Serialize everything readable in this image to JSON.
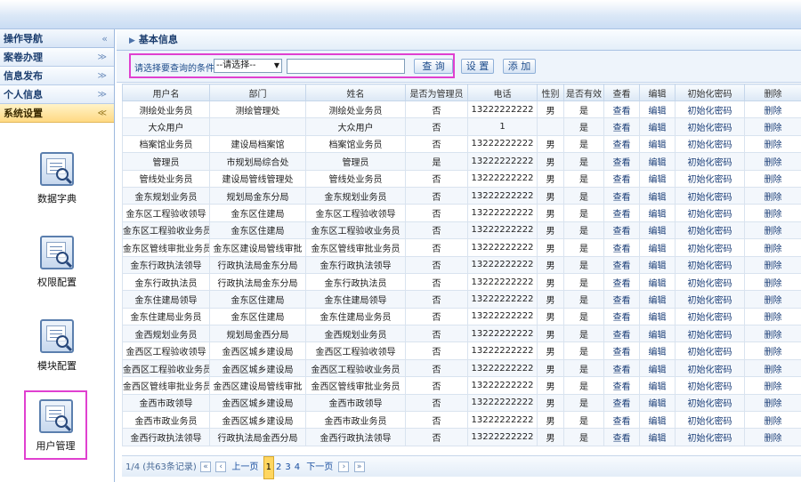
{
  "sidebar": {
    "title": "操作导航",
    "items": [
      {
        "label": "案卷办理"
      },
      {
        "label": "信息发布"
      },
      {
        "label": "个人信息"
      },
      {
        "label": "系统设置"
      }
    ],
    "tools": [
      {
        "label": "数据字典"
      },
      {
        "label": "权限配置"
      },
      {
        "label": "模块配置"
      },
      {
        "label": "用户管理"
      }
    ]
  },
  "main": {
    "breadcrumb": "基本信息",
    "search": {
      "label": "请选择要查询的条件",
      "select_value": "--请选择--",
      "query_button": "查 询",
      "reset_button": "设 置",
      "add_button": "添 加"
    },
    "table": {
      "columns": [
        "用户名",
        "部门",
        "姓名",
        "是否为管理员",
        "电话",
        "性别",
        "是否有效",
        "查看",
        "编辑",
        "初始化密码",
        "删除"
      ],
      "rows": [
        [
          "测绘处业务员",
          "测绘管理处",
          "测绘处业务员",
          "否",
          "13222222222",
          "男",
          "是",
          "查看",
          "编辑",
          "初始化密码",
          "删除"
        ],
        [
          "大众用户",
          "",
          "大众用户",
          "否",
          "1",
          "",
          "是",
          "查看",
          "编辑",
          "初始化密码",
          "删除"
        ],
        [
          "档案馆业务员",
          "建设局档案馆",
          "档案馆业务员",
          "否",
          "13222222222",
          "男",
          "是",
          "查看",
          "编辑",
          "初始化密码",
          "删除"
        ],
        [
          "管理员",
          "市规划局综合处",
          "管理员",
          "是",
          "13222222222",
          "男",
          "是",
          "查看",
          "编辑",
          "初始化密码",
          "删除"
        ],
        [
          "管线处业务员",
          "建设局管线管理处",
          "管线处业务员",
          "否",
          "13222222222",
          "男",
          "是",
          "查看",
          "编辑",
          "初始化密码",
          "删除"
        ],
        [
          "金东规划业务员",
          "规划局金东分局",
          "金东规划业务员",
          "否",
          "13222222222",
          "男",
          "是",
          "查看",
          "编辑",
          "初始化密码",
          "删除"
        ],
        [
          "金东区工程验收领导",
          "金东区住建局",
          "金东区工程验收领导",
          "否",
          "13222222222",
          "男",
          "是",
          "查看",
          "编辑",
          "初始化密码",
          "删除"
        ],
        [
          "金东区工程验收业务员",
          "金东区住建局",
          "金东区工程验收业务员",
          "否",
          "13222222222",
          "男",
          "是",
          "查看",
          "编辑",
          "初始化密码",
          "删除"
        ],
        [
          "金东区管线审批业务员",
          "金东区建设局管线审批",
          "金东区管线审批业务员",
          "否",
          "13222222222",
          "男",
          "是",
          "查看",
          "编辑",
          "初始化密码",
          "删除"
        ],
        [
          "金东行政执法领导",
          "行政执法局金东分局",
          "金东行政执法领导",
          "否",
          "13222222222",
          "男",
          "是",
          "查看",
          "编辑",
          "初始化密码",
          "删除"
        ],
        [
          "金东行政执法员",
          "行政执法局金东分局",
          "金东行政执法员",
          "否",
          "13222222222",
          "男",
          "是",
          "查看",
          "编辑",
          "初始化密码",
          "删除"
        ],
        [
          "金东住建局领导",
          "金东区住建局",
          "金东住建局领导",
          "否",
          "13222222222",
          "男",
          "是",
          "查看",
          "编辑",
          "初始化密码",
          "删除"
        ],
        [
          "金东住建局业务员",
          "金东区住建局",
          "金东住建局业务员",
          "否",
          "13222222222",
          "男",
          "是",
          "查看",
          "编辑",
          "初始化密码",
          "删除"
        ],
        [
          "金西规划业务员",
          "规划局金西分局",
          "金西规划业务员",
          "否",
          "13222222222",
          "男",
          "是",
          "查看",
          "编辑",
          "初始化密码",
          "删除"
        ],
        [
          "金西区工程验收领导",
          "金西区城乡建设局",
          "金西区工程验收领导",
          "否",
          "13222222222",
          "男",
          "是",
          "查看",
          "编辑",
          "初始化密码",
          "删除"
        ],
        [
          "金西区工程验收业务员",
          "金西区城乡建设局",
          "金西区工程验收业务员",
          "否",
          "13222222222",
          "男",
          "是",
          "查看",
          "编辑",
          "初始化密码",
          "删除"
        ],
        [
          "金西区管线审批业务员",
          "金西区建设局管线审批",
          "金西区管线审批业务员",
          "否",
          "13222222222",
          "男",
          "是",
          "查看",
          "编辑",
          "初始化密码",
          "删除"
        ],
        [
          "金西市政领导",
          "金西区城乡建设局",
          "金西市政领导",
          "否",
          "13222222222",
          "男",
          "是",
          "查看",
          "编辑",
          "初始化密码",
          "删除"
        ],
        [
          "金西市政业务员",
          "金西区城乡建设局",
          "金西市政业务员",
          "否",
          "13222222222",
          "男",
          "是",
          "查看",
          "编辑",
          "初始化密码",
          "删除"
        ],
        [
          "金西行政执法领导",
          "行政执法局金西分局",
          "金西行政执法领导",
          "否",
          "13222222222",
          "男",
          "是",
          "查看",
          "编辑",
          "初始化密码",
          "删除"
        ]
      ]
    },
    "pager": {
      "summary": "1/4 (共63条记录)",
      "first": "«",
      "prev_label": "上一页",
      "pages": [
        "1",
        "2",
        "3",
        "4"
      ],
      "current": "1",
      "next_label": "下一页",
      "last": "»"
    }
  }
}
